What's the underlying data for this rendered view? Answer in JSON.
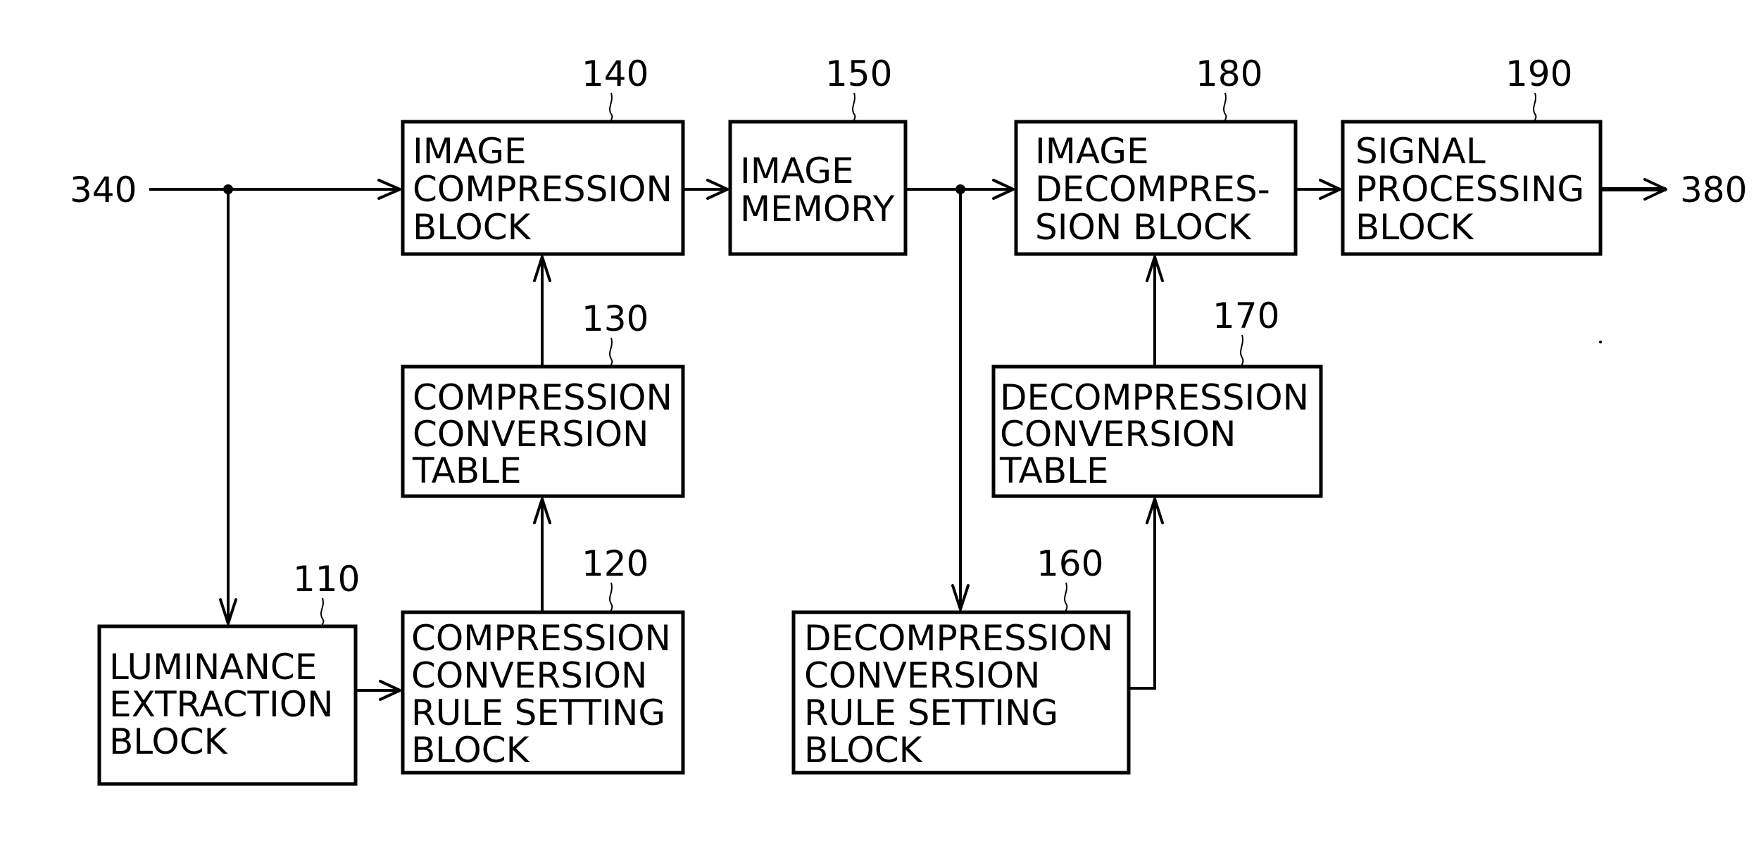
{
  "diagram": {
    "input_signal": "340",
    "output_signal": "380",
    "blocks": {
      "b110": {
        "ref": "110",
        "lines": [
          "LUMINANCE",
          "EXTRACTION",
          "BLOCK"
        ]
      },
      "b120": {
        "ref": "120",
        "lines": [
          "COMPRESSION",
          "CONVERSION",
          "RULE SETTING",
          "BLOCK"
        ]
      },
      "b130": {
        "ref": "130",
        "lines": [
          "COMPRESSION",
          "CONVERSION",
          "TABLE"
        ]
      },
      "b140": {
        "ref": "140",
        "lines": [
          "IMAGE",
          "COMPRESSION",
          "BLOCK"
        ]
      },
      "b150": {
        "ref": "150",
        "lines": [
          "IMAGE",
          "MEMORY"
        ]
      },
      "b160": {
        "ref": "160",
        "lines": [
          "DECOMPRESSION",
          "CONVERSION",
          "RULE SETTING",
          "BLOCK"
        ]
      },
      "b170": {
        "ref": "170",
        "lines": [
          "DECOMPRESSION",
          "CONVERSION",
          "TABLE"
        ]
      },
      "b180": {
        "ref": "180",
        "lines": [
          "IMAGE",
          "DECOMPRES-",
          "SION BLOCK"
        ]
      },
      "b190": {
        "ref": "190",
        "lines": [
          "SIGNAL",
          "PROCESSING",
          "BLOCK"
        ]
      }
    },
    "connections": [
      {
        "from": "340",
        "to": "140"
      },
      {
        "from": "340",
        "to": "110"
      },
      {
        "from": "110",
        "to": "120"
      },
      {
        "from": "120",
        "to": "130"
      },
      {
        "from": "130",
        "to": "140"
      },
      {
        "from": "140",
        "to": "150"
      },
      {
        "from": "150",
        "to": "180"
      },
      {
        "from": "150",
        "to": "160"
      },
      {
        "from": "160",
        "to": "170"
      },
      {
        "from": "170",
        "to": "180"
      },
      {
        "from": "180",
        "to": "190"
      },
      {
        "from": "190",
        "to": "380"
      }
    ]
  }
}
